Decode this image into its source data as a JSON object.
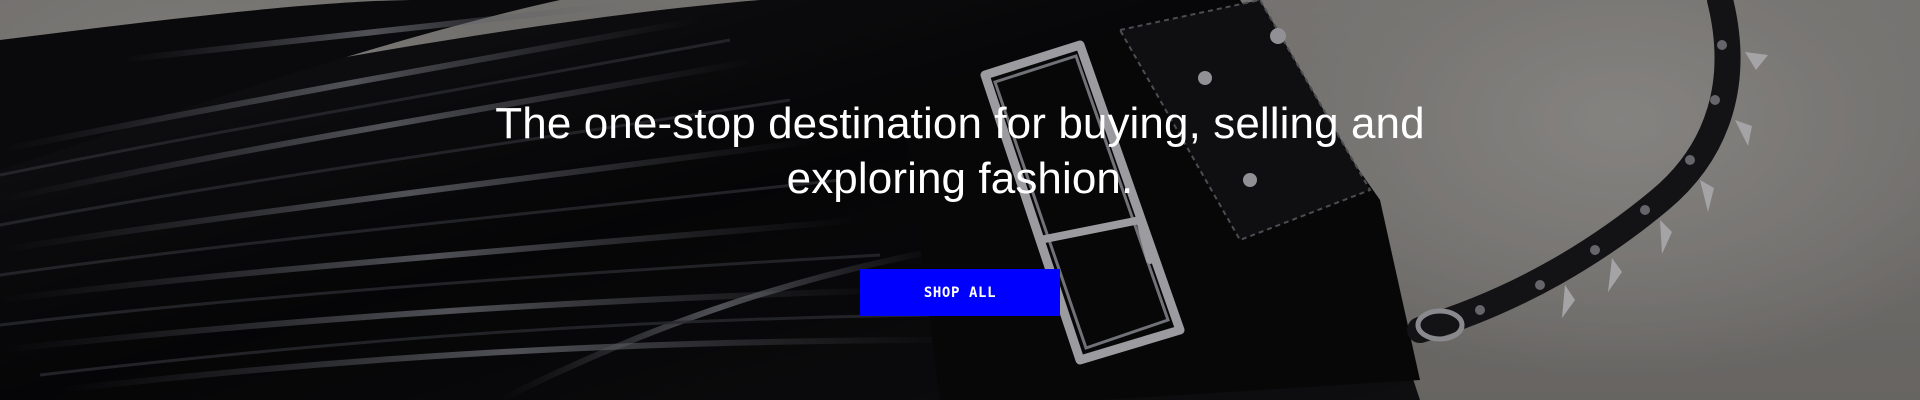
{
  "hero": {
    "headline": "The one-stop destination for buying, selling and exploring fashion.",
    "cta_label": "SHOP ALL",
    "image_description": "black leather fringed bag with silver buckle and spiked strap on grey concrete"
  },
  "colors": {
    "cta_background": "#0000ff",
    "cta_text": "#ffffff",
    "headline_text": "#ffffff",
    "background_concrete": "#9e9b97",
    "leather": "#0c0c0e"
  }
}
